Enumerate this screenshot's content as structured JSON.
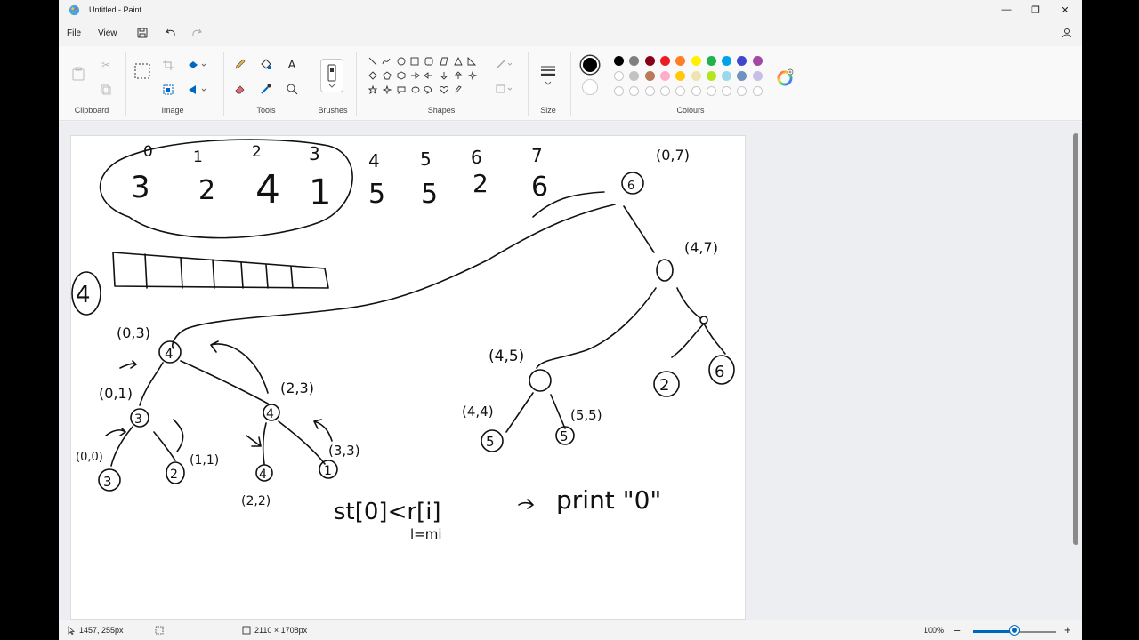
{
  "window": {
    "title": "Untitled - Paint",
    "minimize_icon": "minimize-icon",
    "maximize_icon": "restore-icon",
    "close_icon": "close-icon"
  },
  "menu": {
    "file": "File",
    "view": "View",
    "save_icon": "save-icon",
    "undo_icon": "undo-icon",
    "redo_icon": "redo-icon",
    "settings_icon": "account-settings-icon"
  },
  "ribbon": {
    "groups": {
      "clipboard": "Clipboard",
      "image": "Image",
      "tools": "Tools",
      "brushes": "Brushes",
      "shapes": "Shapes",
      "size": "Size",
      "colours": "Colours"
    },
    "selected_color": "#000000",
    "secondary_color": "#ffffff",
    "palette_row1": [
      "#000000",
      "#7f7f7f",
      "#880015",
      "#ed1c24",
      "#ff7f27",
      "#fff200",
      "#22b14c",
      "#00a2e8",
      "#3f48cc",
      "#a349a4"
    ],
    "palette_row2": [
      "#ffffff",
      "#c3c3c3",
      "#b97a57",
      "#ffaec9",
      "#ffc90e",
      "#efe4b0",
      "#b5e61d",
      "#99d9ea",
      "#7092be",
      "#c8bfe7"
    ]
  },
  "canvas": {
    "top_labels": [
      "0",
      "1",
      "2",
      "3",
      "4",
      "5",
      "6",
      "7"
    ],
    "array_values": [
      "3",
      "2",
      "4",
      "1",
      "5",
      "5",
      "2",
      "6"
    ],
    "root_range": "(0,7)",
    "node_labels": {
      "n_4_7": "(4,7)",
      "n_0_3": "(0,3)",
      "n_0_1": "(0,1)",
      "n_2_3": "(2,3)",
      "n_0_0": "(0,0)",
      "n_1_1": "(1,1)",
      "n_3_3": "(3,3)",
      "n_2_2": "(2,2)",
      "n_4_5": "(4,5)",
      "n_4_4": "(4,4)",
      "n_5_5": "(5,5)"
    },
    "side_number": "4",
    "formula": "st[0]<r[i]",
    "formula_sub": "l=mi",
    "print_text": "print \"0\""
  },
  "status": {
    "cursor_position": "1457, 255px",
    "canvas_size": "2110 × 1708px",
    "zoom": "100%",
    "zoom_fraction": 0.5
  }
}
